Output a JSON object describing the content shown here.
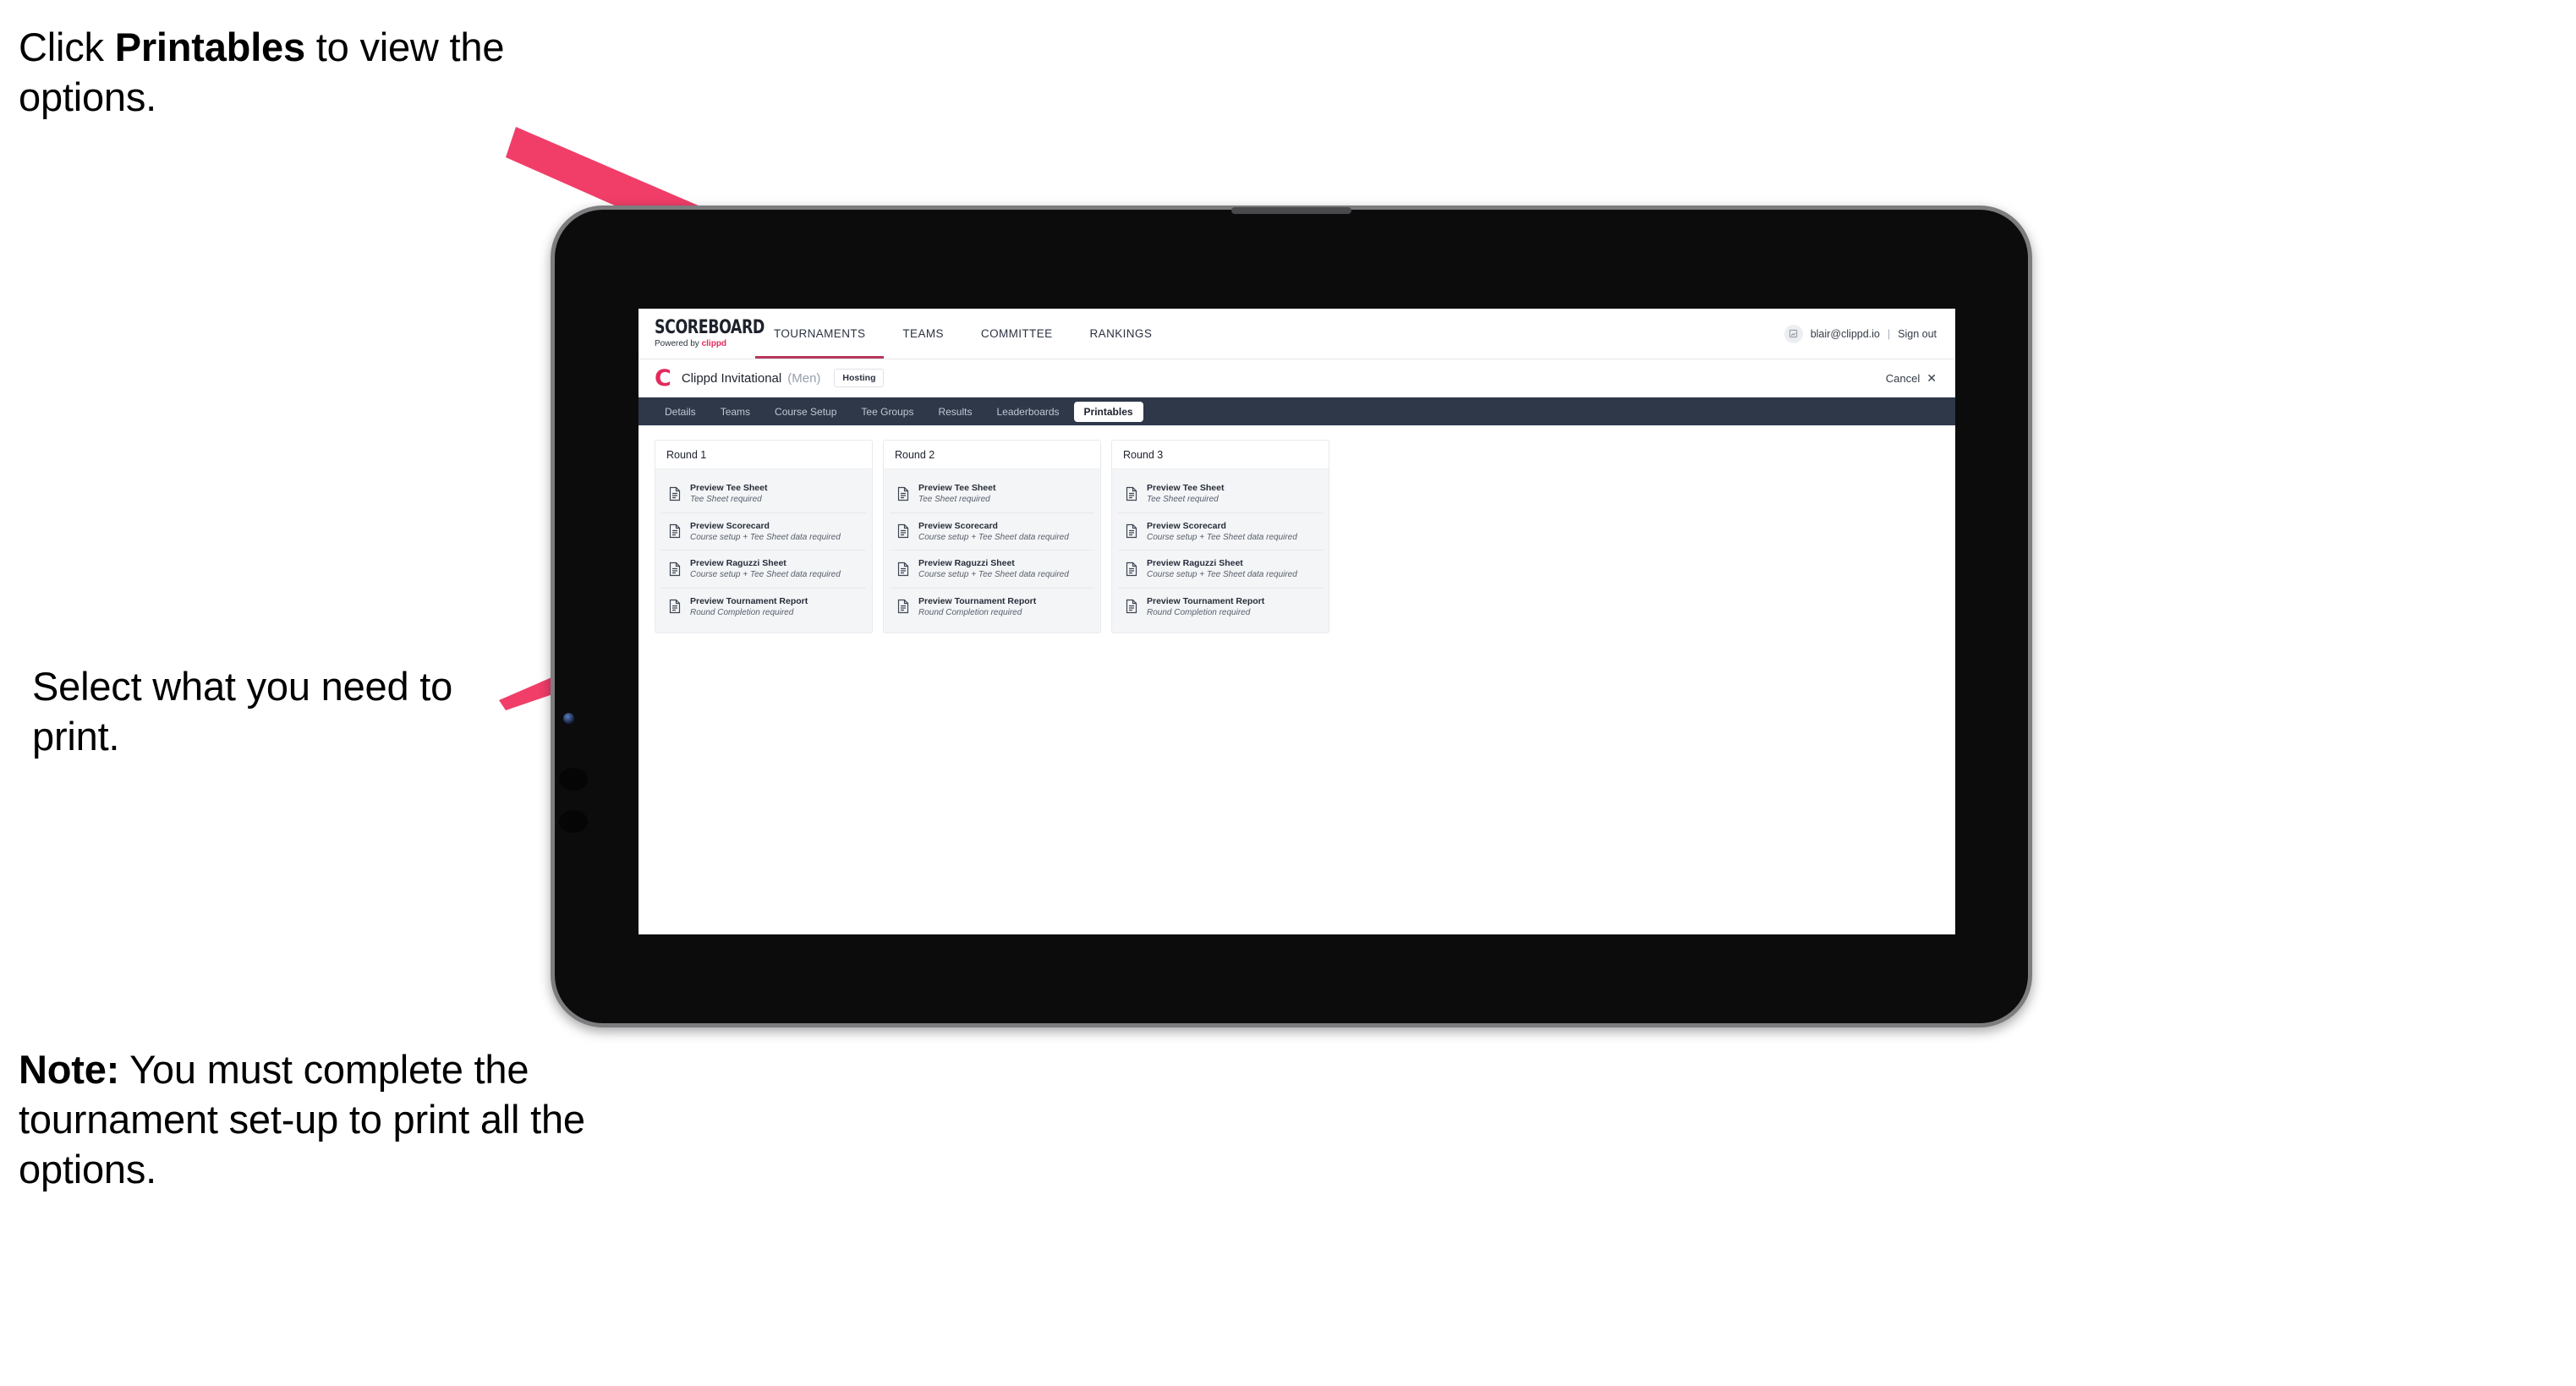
{
  "annotations": {
    "click_printables": {
      "pre": "Click ",
      "bold": "Printables",
      "post": " to view the options."
    },
    "select_print": "Select what you need to print.",
    "note": {
      "bold": "Note:",
      "post": " You must complete the tournament set-up to print all the options."
    }
  },
  "colors": {
    "accent_pink": "#e5285c",
    "arrow_pink": "#f03e69",
    "subnav_dark": "#2e3849",
    "tab_underline": "#b5385a"
  },
  "app": {
    "brand": {
      "title": "SCOREBOARD",
      "sub_pre": "Powered by ",
      "sub_brand": "clippd"
    },
    "nav": [
      {
        "label": "TOURNAMENTS",
        "active": true
      },
      {
        "label": "TEAMS",
        "active": false
      },
      {
        "label": "COMMITTEE",
        "active": false
      },
      {
        "label": "RANKINGS",
        "active": false
      }
    ],
    "user": {
      "avatar_icon": "user-avatar-icon",
      "email": "blair@clippd.io",
      "separator": "|",
      "signout_label": "Sign out"
    },
    "tournament": {
      "logo_letter": "C",
      "name": "Clippd Invitational",
      "gender": "(Men)",
      "badge": "Hosting",
      "cancel_label": "Cancel",
      "cancel_icon": "close-icon"
    },
    "subtabs": [
      {
        "label": "Details",
        "active": false
      },
      {
        "label": "Teams",
        "active": false
      },
      {
        "label": "Course Setup",
        "active": false
      },
      {
        "label": "Tee Groups",
        "active": false
      },
      {
        "label": "Results",
        "active": false
      },
      {
        "label": "Leaderboards",
        "active": false
      },
      {
        "label": "Printables",
        "active": true
      }
    ],
    "rounds": [
      {
        "title": "Round 1",
        "items": [
          {
            "title": "Preview Tee Sheet",
            "sub": "Tee Sheet required"
          },
          {
            "title": "Preview Scorecard",
            "sub": "Course setup + Tee Sheet data required"
          },
          {
            "title": "Preview Raguzzi Sheet",
            "sub": "Course setup + Tee Sheet data required"
          },
          {
            "title": "Preview Tournament Report",
            "sub": "Round Completion required"
          }
        ]
      },
      {
        "title": "Round 2",
        "items": [
          {
            "title": "Preview Tee Sheet",
            "sub": "Tee Sheet required"
          },
          {
            "title": "Preview Scorecard",
            "sub": "Course setup + Tee Sheet data required"
          },
          {
            "title": "Preview Raguzzi Sheet",
            "sub": "Course setup + Tee Sheet data required"
          },
          {
            "title": "Preview Tournament Report",
            "sub": "Round Completion required"
          }
        ]
      },
      {
        "title": "Round 3",
        "items": [
          {
            "title": "Preview Tee Sheet",
            "sub": "Tee Sheet required"
          },
          {
            "title": "Preview Scorecard",
            "sub": "Course setup + Tee Sheet data required"
          },
          {
            "title": "Preview Raguzzi Sheet",
            "sub": "Course setup + Tee Sheet data required"
          },
          {
            "title": "Preview Tournament Report",
            "sub": "Round Completion required"
          }
        ]
      }
    ]
  }
}
